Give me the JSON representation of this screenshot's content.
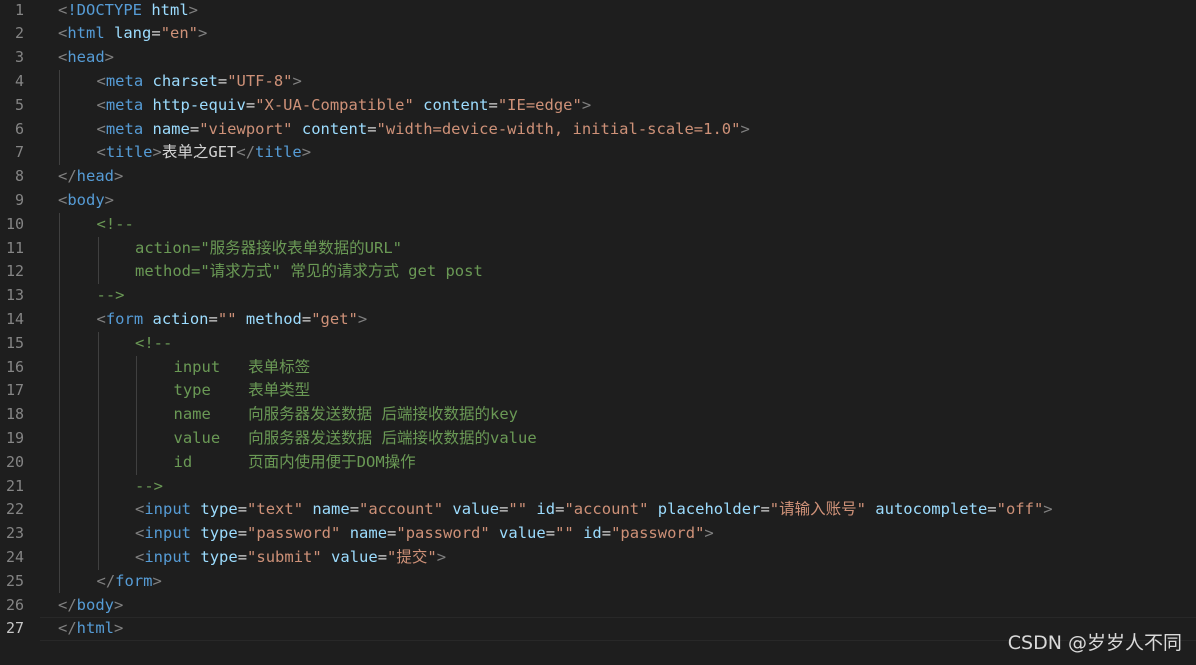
{
  "editor": {
    "active_line": 27,
    "colors": {
      "background": "#1e1e1e",
      "tag": "#569cd6",
      "attribute": "#9cdcfe",
      "string": "#ce9178",
      "punctuation": "#808080",
      "comment": "#6a9955",
      "line_number": "#858585"
    },
    "lines": [
      {
        "n": "1",
        "indent": 0,
        "tokens": [
          [
            "p",
            "<"
          ],
          [
            "tag",
            "!DOCTYPE"
          ],
          [
            "text",
            " "
          ],
          [
            "attr",
            "html"
          ],
          [
            "p",
            ">"
          ]
        ]
      },
      {
        "n": "2",
        "indent": 0,
        "tokens": [
          [
            "p",
            "<"
          ],
          [
            "tag",
            "html"
          ],
          [
            "text",
            " "
          ],
          [
            "attr",
            "lang"
          ],
          [
            "text",
            "="
          ],
          [
            "str",
            "\"en\""
          ],
          [
            "p",
            ">"
          ]
        ]
      },
      {
        "n": "3",
        "indent": 0,
        "tokens": [
          [
            "p",
            "<"
          ],
          [
            "tag",
            "head"
          ],
          [
            "p",
            ">"
          ]
        ]
      },
      {
        "n": "4",
        "indent": 1,
        "tokens": [
          [
            "p",
            "<"
          ],
          [
            "tag",
            "meta"
          ],
          [
            "text",
            " "
          ],
          [
            "attr",
            "charset"
          ],
          [
            "text",
            "="
          ],
          [
            "str",
            "\"UTF-8\""
          ],
          [
            "p",
            ">"
          ]
        ]
      },
      {
        "n": "5",
        "indent": 1,
        "tokens": [
          [
            "p",
            "<"
          ],
          [
            "tag",
            "meta"
          ],
          [
            "text",
            " "
          ],
          [
            "attr",
            "http-equiv"
          ],
          [
            "text",
            "="
          ],
          [
            "str",
            "\"X-UA-Compatible\""
          ],
          [
            "text",
            " "
          ],
          [
            "attr",
            "content"
          ],
          [
            "text",
            "="
          ],
          [
            "str",
            "\"IE=edge\""
          ],
          [
            "p",
            ">"
          ]
        ]
      },
      {
        "n": "6",
        "indent": 1,
        "tokens": [
          [
            "p",
            "<"
          ],
          [
            "tag",
            "meta"
          ],
          [
            "text",
            " "
          ],
          [
            "attr",
            "name"
          ],
          [
            "text",
            "="
          ],
          [
            "str",
            "\"viewport\""
          ],
          [
            "text",
            " "
          ],
          [
            "attr",
            "content"
          ],
          [
            "text",
            "="
          ],
          [
            "str",
            "\"width=device-width, initial-scale=1.0\""
          ],
          [
            "p",
            ">"
          ]
        ]
      },
      {
        "n": "7",
        "indent": 1,
        "tokens": [
          [
            "p",
            "<"
          ],
          [
            "tag",
            "title"
          ],
          [
            "p",
            ">"
          ],
          [
            "text",
            "表单之GET"
          ],
          [
            "p",
            "</"
          ],
          [
            "tag",
            "title"
          ],
          [
            "p",
            ">"
          ]
        ]
      },
      {
        "n": "8",
        "indent": 0,
        "tokens": [
          [
            "p",
            "</"
          ],
          [
            "tag",
            "head"
          ],
          [
            "p",
            ">"
          ]
        ]
      },
      {
        "n": "9",
        "indent": 0,
        "tokens": [
          [
            "p",
            "<"
          ],
          [
            "tag",
            "body"
          ],
          [
            "p",
            ">"
          ]
        ]
      },
      {
        "n": "10",
        "indent": 1,
        "tokens": [
          [
            "cmt",
            "<!--"
          ]
        ]
      },
      {
        "n": "11",
        "indent": 2,
        "tokens": [
          [
            "cmt",
            "action=\"服务器接收表单数据的URL\""
          ]
        ]
      },
      {
        "n": "12",
        "indent": 2,
        "tokens": [
          [
            "cmt",
            "method=\"请求方式\" 常见的请求方式 get post"
          ]
        ]
      },
      {
        "n": "13",
        "indent": 1,
        "tokens": [
          [
            "cmt",
            "-->"
          ]
        ]
      },
      {
        "n": "14",
        "indent": 1,
        "tokens": [
          [
            "p",
            "<"
          ],
          [
            "tag",
            "form"
          ],
          [
            "text",
            " "
          ],
          [
            "attr",
            "action"
          ],
          [
            "text",
            "="
          ],
          [
            "str",
            "\"\""
          ],
          [
            "text",
            " "
          ],
          [
            "attr",
            "method"
          ],
          [
            "text",
            "="
          ],
          [
            "str",
            "\"get\""
          ],
          [
            "p",
            ">"
          ]
        ]
      },
      {
        "n": "15",
        "indent": 2,
        "tokens": [
          [
            "cmt",
            "<!--"
          ]
        ]
      },
      {
        "n": "16",
        "indent": 3,
        "tokens": [
          [
            "cmt",
            "input   表单标签"
          ]
        ]
      },
      {
        "n": "17",
        "indent": 3,
        "tokens": [
          [
            "cmt",
            "type    表单类型"
          ]
        ]
      },
      {
        "n": "18",
        "indent": 3,
        "tokens": [
          [
            "cmt",
            "name    向服务器发送数据 后端接收数据的key"
          ]
        ]
      },
      {
        "n": "19",
        "indent": 3,
        "tokens": [
          [
            "cmt",
            "value   向服务器发送数据 后端接收数据的value"
          ]
        ]
      },
      {
        "n": "20",
        "indent": 3,
        "tokens": [
          [
            "cmt",
            "id      页面内使用便于DOM操作"
          ]
        ]
      },
      {
        "n": "21",
        "indent": 2,
        "tokens": [
          [
            "cmt",
            "-->"
          ]
        ]
      },
      {
        "n": "22",
        "indent": 2,
        "tokens": [
          [
            "p",
            "<"
          ],
          [
            "tag",
            "input"
          ],
          [
            "text",
            " "
          ],
          [
            "attr",
            "type"
          ],
          [
            "text",
            "="
          ],
          [
            "str",
            "\"text\""
          ],
          [
            "text",
            " "
          ],
          [
            "attr",
            "name"
          ],
          [
            "text",
            "="
          ],
          [
            "str",
            "\"account\""
          ],
          [
            "text",
            " "
          ],
          [
            "attr",
            "value"
          ],
          [
            "text",
            "="
          ],
          [
            "str",
            "\"\""
          ],
          [
            "text",
            " "
          ],
          [
            "attr",
            "id"
          ],
          [
            "text",
            "="
          ],
          [
            "str",
            "\"account\""
          ],
          [
            "text",
            " "
          ],
          [
            "attr",
            "placeholder"
          ],
          [
            "text",
            "="
          ],
          [
            "str",
            "\"请输入账号\""
          ],
          [
            "text",
            " "
          ],
          [
            "attr",
            "autocomplete"
          ],
          [
            "text",
            "="
          ],
          [
            "str",
            "\"off\""
          ],
          [
            "p",
            ">"
          ]
        ]
      },
      {
        "n": "23",
        "indent": 2,
        "tokens": [
          [
            "p",
            "<"
          ],
          [
            "tag",
            "input"
          ],
          [
            "text",
            " "
          ],
          [
            "attr",
            "type"
          ],
          [
            "text",
            "="
          ],
          [
            "str",
            "\"password\""
          ],
          [
            "text",
            " "
          ],
          [
            "attr",
            "name"
          ],
          [
            "text",
            "="
          ],
          [
            "str",
            "\"password\""
          ],
          [
            "text",
            " "
          ],
          [
            "attr",
            "value"
          ],
          [
            "text",
            "="
          ],
          [
            "str",
            "\"\""
          ],
          [
            "text",
            " "
          ],
          [
            "attr",
            "id"
          ],
          [
            "text",
            "="
          ],
          [
            "str",
            "\"password\""
          ],
          [
            "p",
            ">"
          ]
        ]
      },
      {
        "n": "24",
        "indent": 2,
        "tokens": [
          [
            "p",
            "<"
          ],
          [
            "tag",
            "input"
          ],
          [
            "text",
            " "
          ],
          [
            "attr",
            "type"
          ],
          [
            "text",
            "="
          ],
          [
            "str",
            "\"submit\""
          ],
          [
            "text",
            " "
          ],
          [
            "attr",
            "value"
          ],
          [
            "text",
            "="
          ],
          [
            "str",
            "\"提交\""
          ],
          [
            "p",
            ">"
          ]
        ]
      },
      {
        "n": "25",
        "indent": 1,
        "tokens": [
          [
            "p",
            "</"
          ],
          [
            "tag",
            "form"
          ],
          [
            "p",
            ">"
          ]
        ]
      },
      {
        "n": "26",
        "indent": 0,
        "tokens": [
          [
            "p",
            "</"
          ],
          [
            "tag",
            "body"
          ],
          [
            "p",
            ">"
          ]
        ]
      },
      {
        "n": "27",
        "indent": 0,
        "tokens": [
          [
            "p",
            "</"
          ],
          [
            "tag",
            "html"
          ],
          [
            "p",
            ">"
          ]
        ]
      }
    ]
  },
  "watermark": "CSDN @岁岁人不同"
}
